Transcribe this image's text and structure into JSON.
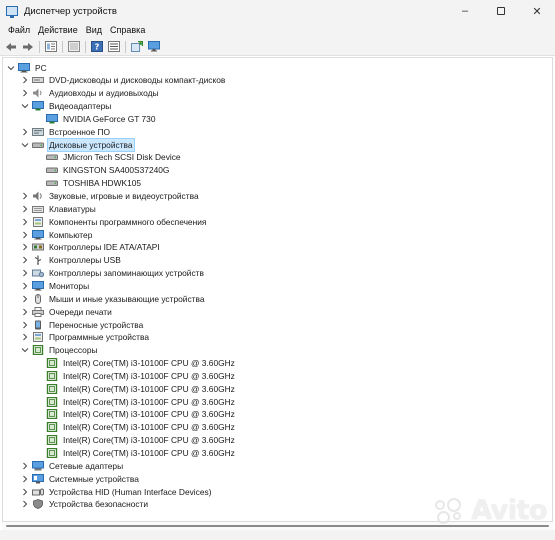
{
  "window": {
    "title": "Диспетчер устройств",
    "controls": {
      "minimize": "–",
      "maximize": "",
      "close": "✕"
    }
  },
  "menubar": [
    "Файл",
    "Действие",
    "Вид",
    "Справка"
  ],
  "toolbar": [
    "back-icon",
    "forward-icon",
    "properties-icon",
    "show-hidden-icon",
    "help-icon",
    "device-list-icon",
    "scan-hardware-icon",
    "monitor-icon"
  ],
  "tree": {
    "root": "PC",
    "rows": [
      {
        "label": "PC",
        "level": 0,
        "expanded": true,
        "icon": "computer"
      },
      {
        "label": "DVD-дисководы и дисководы компакт-дисков",
        "level": 1,
        "expanded": false,
        "icon": "dvd"
      },
      {
        "label": "Аудиовходы и аудиовыходы",
        "level": 1,
        "expanded": false,
        "icon": "audio"
      },
      {
        "label": "Видеоадаптеры",
        "level": 1,
        "expanded": true,
        "icon": "display-adapter"
      },
      {
        "label": "NVIDIA GeForce GT 730",
        "level": 2,
        "icon": "display-adapter"
      },
      {
        "label": "Встроенное ПО",
        "level": 1,
        "expanded": false,
        "icon": "firmware"
      },
      {
        "label": "Дисковые устройства",
        "level": 1,
        "expanded": true,
        "icon": "disk",
        "selected": true
      },
      {
        "label": "JMicron Tech SCSI Disk Device",
        "level": 2,
        "icon": "disk"
      },
      {
        "label": "KINGSTON SA400S37240G",
        "level": 2,
        "icon": "disk"
      },
      {
        "label": "TOSHIBA HDWK105",
        "level": 2,
        "icon": "disk"
      },
      {
        "label": "Звуковые, игровые и видеоустройства",
        "level": 1,
        "expanded": false,
        "icon": "sound"
      },
      {
        "label": "Клавиатуры",
        "level": 1,
        "expanded": false,
        "icon": "keyboard"
      },
      {
        "label": "Компоненты программного обеспечения",
        "level": 1,
        "expanded": false,
        "icon": "software"
      },
      {
        "label": "Компьютер",
        "level": 1,
        "expanded": false,
        "icon": "monitor"
      },
      {
        "label": "Контроллеры IDE ATA/ATAPI",
        "level": 1,
        "expanded": false,
        "icon": "ide"
      },
      {
        "label": "Контроллеры USB",
        "level": 1,
        "expanded": false,
        "icon": "usb"
      },
      {
        "label": "Контроллеры запоминающих устройств",
        "level": 1,
        "expanded": false,
        "icon": "storage"
      },
      {
        "label": "Мониторы",
        "level": 1,
        "expanded": false,
        "icon": "monitor"
      },
      {
        "label": "Мыши и иные указывающие устройства",
        "level": 1,
        "expanded": false,
        "icon": "mouse"
      },
      {
        "label": "Очереди печати",
        "level": 1,
        "expanded": false,
        "icon": "printer"
      },
      {
        "label": "Переносные устройства",
        "level": 1,
        "expanded": false,
        "icon": "portable"
      },
      {
        "label": "Программные устройства",
        "level": 1,
        "expanded": false,
        "icon": "software"
      },
      {
        "label": "Процессоры",
        "level": 1,
        "expanded": true,
        "icon": "cpu"
      },
      {
        "label": "Intel(R) Core(TM) i3-10100F CPU @ 3.60GHz",
        "level": 2,
        "icon": "cpu"
      },
      {
        "label": "Intel(R) Core(TM) i3-10100F CPU @ 3.60GHz",
        "level": 2,
        "icon": "cpu"
      },
      {
        "label": "Intel(R) Core(TM) i3-10100F CPU @ 3.60GHz",
        "level": 2,
        "icon": "cpu"
      },
      {
        "label": "Intel(R) Core(TM) i3-10100F CPU @ 3.60GHz",
        "level": 2,
        "icon": "cpu"
      },
      {
        "label": "Intel(R) Core(TM) i3-10100F CPU @ 3.60GHz",
        "level": 2,
        "icon": "cpu"
      },
      {
        "label": "Intel(R) Core(TM) i3-10100F CPU @ 3.60GHz",
        "level": 2,
        "icon": "cpu"
      },
      {
        "label": "Intel(R) Core(TM) i3-10100F CPU @ 3.60GHz",
        "level": 2,
        "icon": "cpu"
      },
      {
        "label": "Intel(R) Core(TM) i3-10100F CPU @ 3.60GHz",
        "level": 2,
        "icon": "cpu"
      },
      {
        "label": "Сетевые адаптеры",
        "level": 1,
        "expanded": false,
        "icon": "network"
      },
      {
        "label": "Системные устройства",
        "level": 1,
        "expanded": false,
        "icon": "system"
      },
      {
        "label": "Устройства HID (Human Interface Devices)",
        "level": 1,
        "expanded": false,
        "icon": "hid"
      },
      {
        "label": "Устройства безопасности",
        "level": 1,
        "expanded": false,
        "icon": "security"
      }
    ]
  },
  "watermark": {
    "text": "Avito"
  },
  "colors": {
    "selection": "#cce8ff",
    "accent": "#2b6cb0",
    "cpu_green": "#3a7d2b"
  }
}
